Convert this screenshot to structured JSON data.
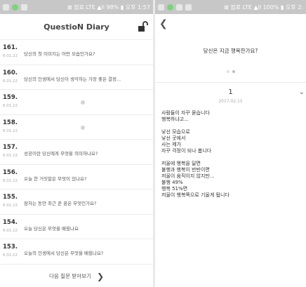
{
  "left": {
    "status": {
      "text": "⊠ 잠료 LTE ▲ll 98% ▮ 오후 1:57"
    },
    "title": "QuestioN Diary",
    "rows": [
      {
        "num": "161.",
        "date": "6.01.22",
        "question": "당신의 첫 이미지는 어떤 모습인가요?",
        "placeholder": false
      },
      {
        "num": "160.",
        "date": "6.01.22",
        "question": "당신의 인생에서 당신이 생각하는 가장 좋은 결정...",
        "placeholder": false
      },
      {
        "num": "159.",
        "date": "6.01.22",
        "question": "",
        "placeholder": true
      },
      {
        "num": "158.",
        "date": "6.01.22",
        "question": "",
        "placeholder": true
      },
      {
        "num": "157.",
        "date": "6.01.22",
        "question": "성공이란 당신에게 무엇을 의미하나요?",
        "placeholder": false
      },
      {
        "num": "156.",
        "date": "6.01.22",
        "question": "오늘 한 거짓말은 무엇이 있나요?",
        "placeholder": false
      },
      {
        "num": "155.",
        "date": "6.01.22",
        "question": "잠자는 동안 최근 꾼 꿈은 무엇인가요?",
        "placeholder": false
      },
      {
        "num": "154.",
        "date": "6.01.22",
        "question": "오늘 당신은 무엇을 배웠나요",
        "placeholder": false
      },
      {
        "num": "153.",
        "date": "6.01.22",
        "question": "오늘의 인생에서 당신은 무엇을 배웠나요?",
        "placeholder": false
      }
    ],
    "next_label": "다음 질문 받아보기",
    "next_arrow": "❯"
  },
  "right": {
    "status": {
      "text": "⊠ 잠료 LTE ▲ll 100% ▮ 오후 2:"
    },
    "back_arrow": "❮",
    "question": "당신은 지금 행복한가요?",
    "entry_number": "1",
    "entry_date": "2017.02.15",
    "chevron": "⌄",
    "body_lines": [
      "사람들이 자꾸 묻습니다",
      "행복하냐고...",
      "",
      "낯선 모습으로",
      "낯선 곳에서",
      "사는 제가",
      "자꾸 걱정이 되나 봅니다",
      "",
      "저울에 행복을 달면",
      "불행과 행복이 반반이면",
      "저울이 움직이지 않지만...",
      "불행 49%",
      "행복 51%면",
      "저울이 행복쪽으로 기울게 됩니다"
    ]
  }
}
